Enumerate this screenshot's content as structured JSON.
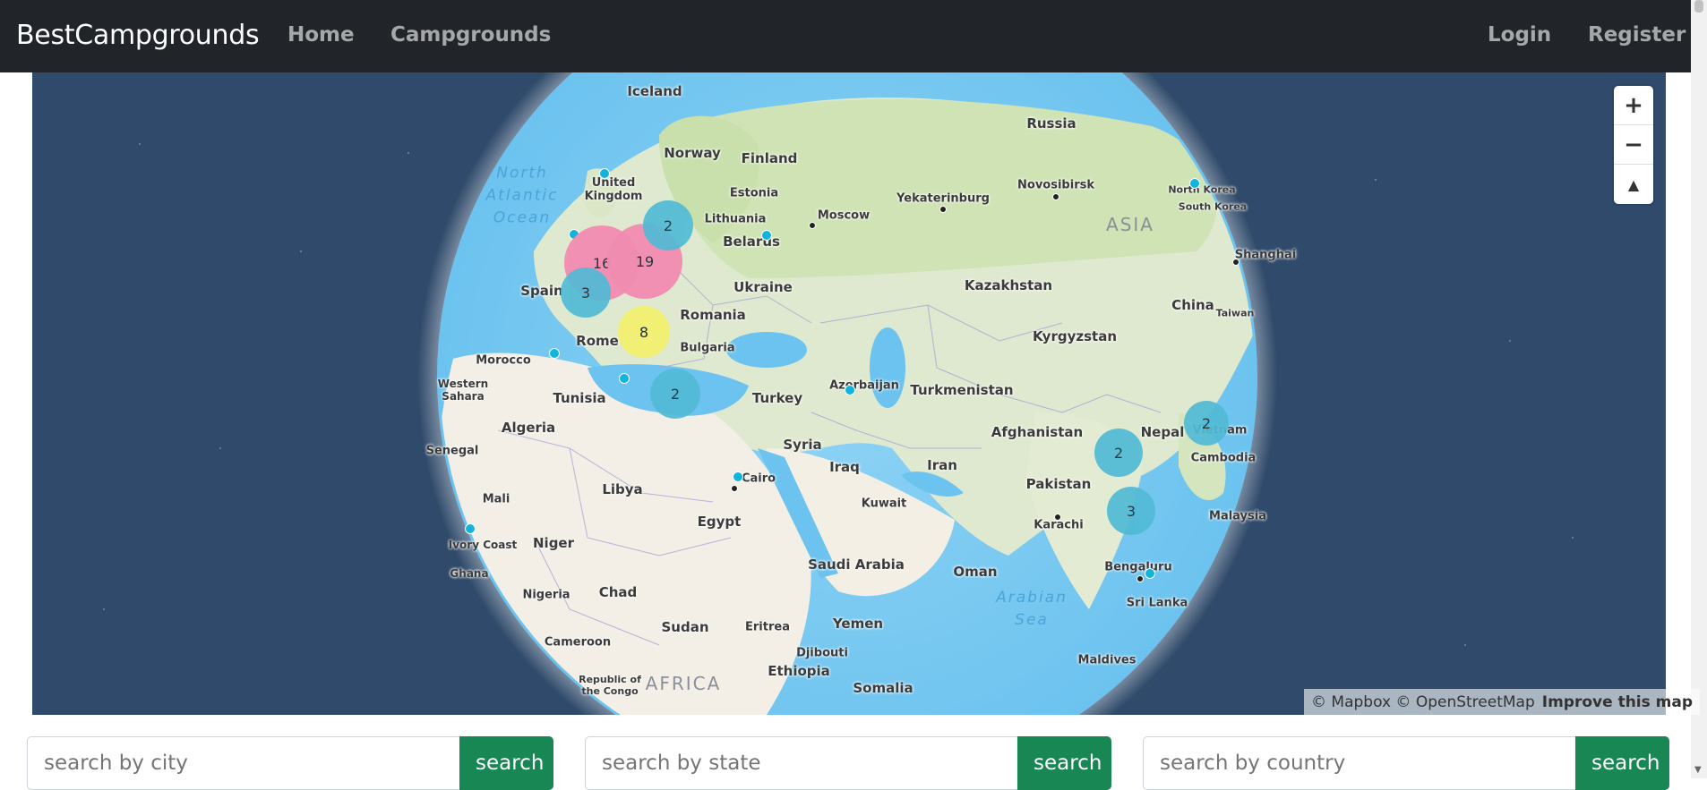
{
  "navbar": {
    "brand": "BestCampgrounds",
    "links": [
      "Home",
      "Campgrounds"
    ],
    "right_links": [
      "Login",
      "Register"
    ]
  },
  "map": {
    "place_labels": {
      "iceland": "Iceland",
      "norway": "Norway",
      "finland": "Finland",
      "russia": "Russia",
      "united_kingdom": "United\nKingdom",
      "estonia": "Estonia",
      "lithuania": "Lithuania",
      "belarus": "Belarus",
      "moscow": "Moscow",
      "yekaterinburg": "Yekaterinburg",
      "novosibirsk": "Novosibirsk",
      "north_korea": "North Korea",
      "south_korea": "South Korea",
      "shanghai": "Shanghai",
      "taiwan": "Taiwan",
      "china": "China",
      "asia": "ASIA",
      "kazakhstan": "Kazakhstan",
      "kyrgyzstan": "Kyrgyzstan",
      "ukraine": "Ukraine",
      "romania": "Romania",
      "bulgaria": "Bulgaria",
      "spain": "Spain",
      "rome": "Rome",
      "morocco": "Morocco",
      "western_sahara": "Western\nSahara",
      "tunisia": "Tunisia",
      "turkey": "Turkey",
      "azerbaijan": "Azerbaijan",
      "turkmenistan": "Turkmenistan",
      "afghanistan": "Afghanistan",
      "nepal": "Nepal",
      "vietnam": "Vietnam",
      "cambodia": "Cambodia",
      "malaysia": "Malaysia",
      "pakistan": "Pakistan",
      "karachi": "Karachi",
      "iran": "Iran",
      "iraq": "Iraq",
      "syria": "Syria",
      "kuwait": "Kuwait",
      "cairo": "Cairo",
      "egypt": "Egypt",
      "libya": "Libya",
      "algeria": "Algeria",
      "senegal": "Senegal",
      "mali": "Mali",
      "niger": "Niger",
      "chad": "Chad",
      "nigeria": "Nigeria",
      "ivory_coast": "Ivory Coast",
      "ghana": "Ghana",
      "saudi_arabia": "Saudi Arabia",
      "oman": "Oman",
      "yemen": "Yemen",
      "sudan": "Sudan",
      "eritrea": "Eritrea",
      "djibouti": "Djibouti",
      "ethiopia": "Ethiopia",
      "somalia": "Somalia",
      "cameroon": "Cameroon",
      "republic_congo": "Republic of\nthe Congo",
      "africa": "AFRICA",
      "bengaluru": "Bengaluru",
      "sri_lanka": "Sri Lanka",
      "maldives": "Maldives",
      "north_atlantic": "North\nAtlantic\nOcean",
      "arabian_sea": "Arabian\nSea"
    },
    "clusters": {
      "c1": "2",
      "c2": "16",
      "c3": "19",
      "c4": "3",
      "c5": "8",
      "c6": "2",
      "c7": "2",
      "c8": "2",
      "c9": "3"
    },
    "zoom_in": "+",
    "zoom_out": "−",
    "compass": "▲",
    "attribution": "© Mapbox © OpenStreetMap",
    "improve": "Improve this map",
    "logo": "mapbox"
  },
  "search": {
    "city_placeholder": "search by city",
    "state_placeholder": "search by state",
    "country_placeholder": "search by country",
    "button_label": "search"
  },
  "colors": {
    "navbar": "#212529",
    "button": "#198754",
    "cluster_small": "#51bbd6",
    "cluster_medium": "#f1f075",
    "cluster_large": "#f28cb1",
    "point": "#11b4da"
  }
}
